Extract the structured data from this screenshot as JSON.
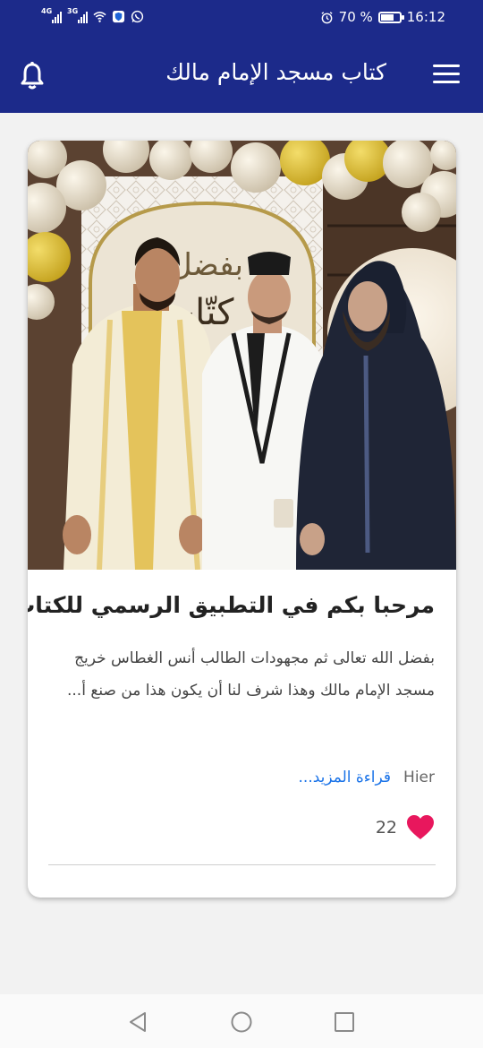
{
  "status_bar": {
    "network_1": "4G",
    "network_2": "3G",
    "battery": "70 %",
    "battery_level": 0.7,
    "time": "16:12",
    "icons": [
      "signal-icon",
      "wifi-icon",
      "shield-icon",
      "whatsapp-icon",
      "alarm-icon",
      "battery-icon"
    ]
  },
  "app_bar": {
    "title": "كتاب مسجد الإمام مالك",
    "left_icon": "bell-icon",
    "right_icon": "menu-icon"
  },
  "post": {
    "title": "مرحبا بكم في التطبيق الرسمي للكتاب",
    "excerpt": "بفضل الله تعالى ثم مجهودات الطالب أنس الغطاس خريج مسجد الإمام مالك وهذا شرف لنا أن يكون هذا من صنع أ...",
    "date": "Hier",
    "read_more": "قراءة المزيد...",
    "likes": "22",
    "image_text": "كتّاب",
    "accent": "#e8175d"
  },
  "nav_bar": {
    "icons": [
      "back-icon",
      "home-icon",
      "recents-icon"
    ]
  },
  "colors": {
    "primary": "#1c2a8a",
    "link": "#1a73e8",
    "heart": "#e8175d"
  }
}
